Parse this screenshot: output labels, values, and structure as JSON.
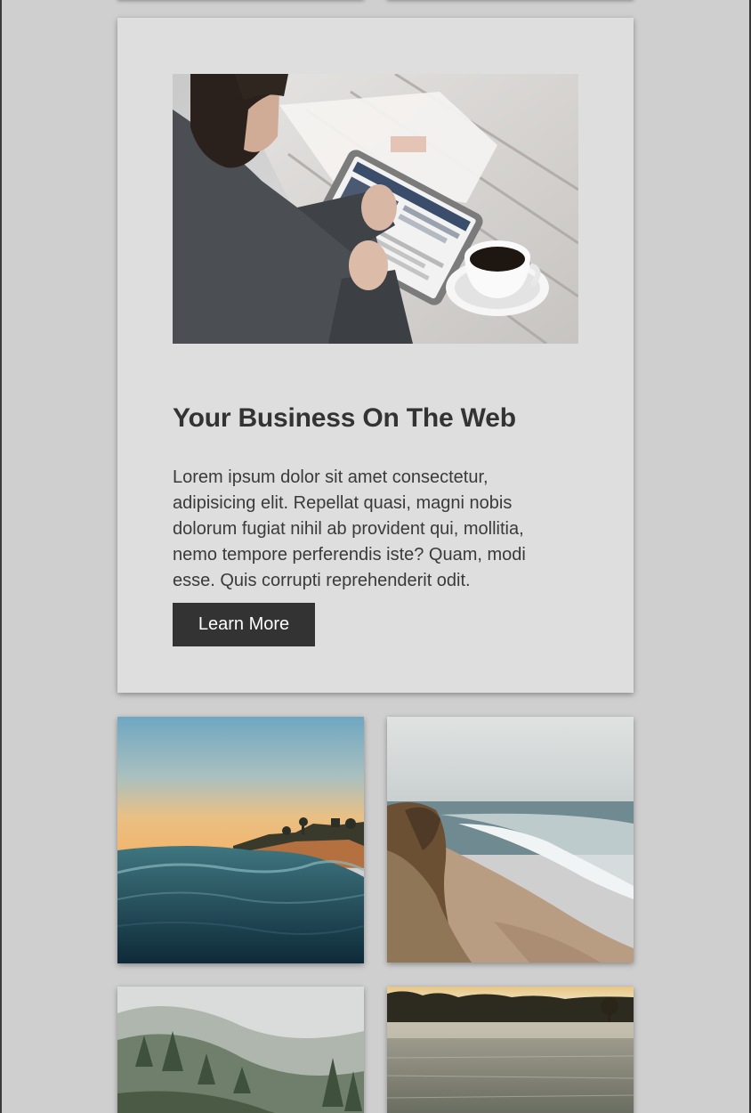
{
  "hero": {
    "title": "Your Business On The Web",
    "text": "Lorem ipsum dolor sit amet consectetur, adipisicing elit. Repellat quasi, magni nobis dolorum fugiat nihil ab provident qui, mollitia, nemo tempore perferendis iste? Quam, modi esse. Quis corrupti reprehenderit odit.",
    "button_label": "Learn More",
    "photo": "man-with-tablet-and-coffee-photo"
  },
  "gallery": [
    {
      "photo": "ocean-wave-sunset-photo"
    },
    {
      "photo": "coastal-cliff-beach-photo"
    },
    {
      "photo": "foggy-forest-hills-photo"
    },
    {
      "photo": "frosty-field-sunrise-photo"
    }
  ],
  "colors": {
    "page_background": "#cfcfcf",
    "card_background": "#dedede",
    "button_background": "#333333",
    "heading_text": "#333333"
  }
}
